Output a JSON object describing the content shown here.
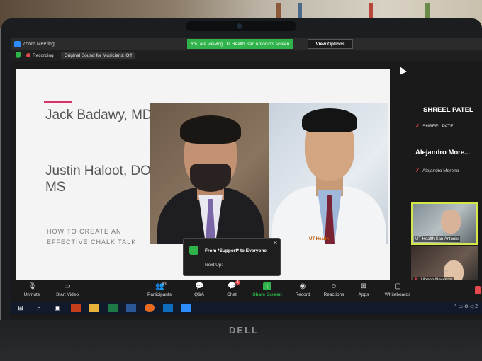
{
  "window": {
    "title": "Zoom Meeting"
  },
  "banner": {
    "viewing_text": "You are viewing UT Health San Antonio's screen",
    "view_options": "View Options"
  },
  "status": {
    "recording": "Recording",
    "original_sound": "Original Sound for Musicians: Off"
  },
  "slide": {
    "name1": "Jack Badawy, MD",
    "name2": "Justin Haloot, DO, MS",
    "topic": "HOW TO CREATE AN EFFECTIVE CHALK TALK",
    "photo_logo": "UT Health"
  },
  "chat_popup": {
    "from": "From *Support* to Everyone",
    "message": "Next Up:"
  },
  "panel": {
    "speaker1_name": "SHREEL PATEL",
    "speaker1_label": "SHREEL PATEL",
    "speaker2_name": "Alejandro  More...",
    "speaker2_label": "Alejandro Moreno",
    "tile1_label": "UT Health San Antonio",
    "tile2_label": "Megan Newman"
  },
  "toolbar": {
    "unmute": "Unmute",
    "start_video": "Start Video",
    "participants": "Participants",
    "participants_count": "43",
    "qa": "Q&A",
    "chat": "Chat",
    "chat_badge": "1",
    "share_screen": "Share Screen",
    "record": "Record",
    "reactions": "Reactions",
    "apps": "Apps",
    "whiteboards": "Whiteboards"
  },
  "taskbar": {
    "tray_text": "^ ▭ ⊕ ◁ 2"
  },
  "laptop": {
    "brand": "DELL"
  },
  "colors": {
    "zoom_blue": "#2d8cff",
    "share_green": "#2fb34a",
    "accent_pink": "#d6336c",
    "mic_red": "#e5484d"
  }
}
